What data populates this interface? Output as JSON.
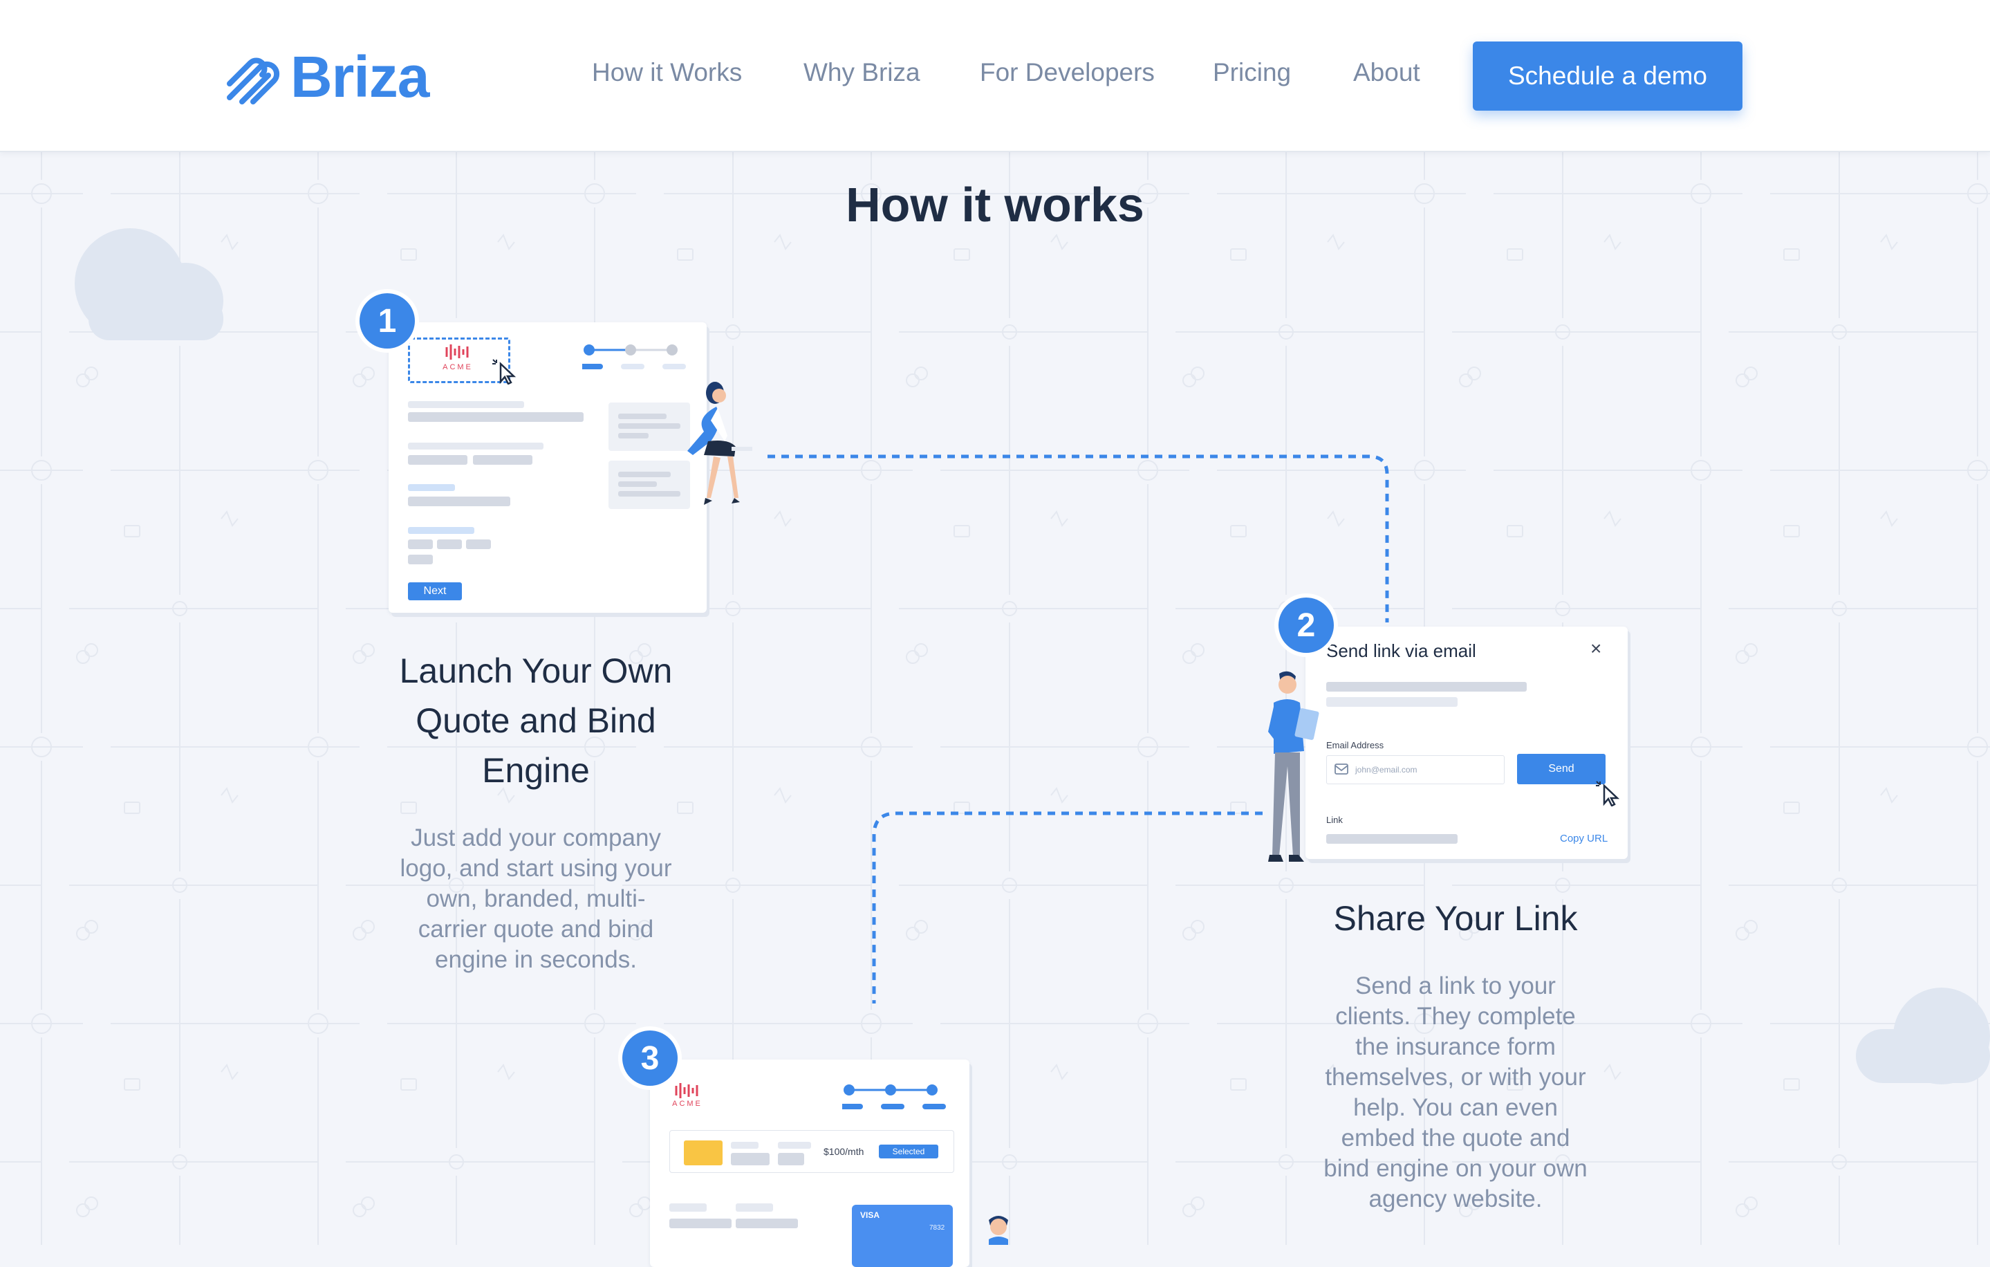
{
  "header": {
    "logo_text": "Briza",
    "nav": [
      "How it Works",
      "Why Briza",
      "For Developers",
      "Pricing",
      "About"
    ],
    "cta_label": "Schedule a demo"
  },
  "section": {
    "title": "How it works"
  },
  "steps": [
    {
      "number": "1",
      "title_lines": [
        "Launch Your Own",
        "Quote and Bind",
        "Engine"
      ],
      "text_lines": [
        "Just add your company",
        "logo, and start using your",
        "own, branded, multi-",
        "carrier quote and bind",
        "engine in seconds."
      ],
      "card": {
        "brand": "ACME",
        "button": "Next"
      }
    },
    {
      "number": "2",
      "title_lines": [
        "Share Your Link"
      ],
      "text_lines": [
        "Send a link to your",
        "clients. They complete",
        "the insurance form",
        "themselves, or with your",
        "help. You can even",
        "embed the quote and",
        "bind engine on your own",
        "agency website."
      ],
      "card": {
        "title": "Send link via email",
        "close": "×",
        "email_label": "Email Address",
        "email_placeholder": "john@email.com",
        "send_button": "Send",
        "link_label": "Link",
        "copy_url": "Copy URL"
      }
    },
    {
      "number": "3",
      "card": {
        "brand": "ACME",
        "price": "$100/mth",
        "selected": "Selected",
        "card_brand": "VISA",
        "card_digits": "7832"
      }
    }
  ],
  "colors": {
    "accent": "#3b87e8",
    "heading": "#1f2d44",
    "muted": "#8492aa",
    "background": "#f3f5fa"
  }
}
